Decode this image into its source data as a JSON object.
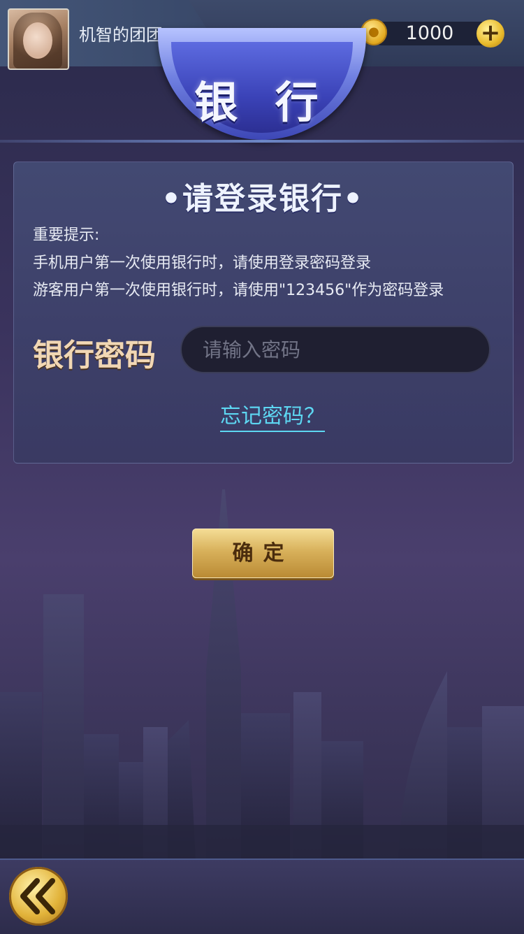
{
  "header": {
    "username": "机智的团团",
    "coins": "1000",
    "coin_glyph": "●",
    "plus_label": "+"
  },
  "banner": {
    "title": "银 行"
  },
  "panel": {
    "title": "•请登录银行•",
    "hints": [
      "重要提示:",
      "手机用户第一次使用银行时，请使用登录密码登录",
      "游客用户第一次使用银行时，请使用\"123456\"作为密码登录"
    ],
    "password_label": "银行密码",
    "password_placeholder": "请输入密码",
    "password_value": "",
    "forgot_link": "忘记密码？"
  },
  "confirm_label": "确定",
  "colors": {
    "accent_link": "#5dd7f2",
    "gold": "#d8b15b",
    "label_gold": "#f1d7b4"
  },
  "icons": {
    "coin": "coin-icon",
    "plus": "plus-icon",
    "back": "double-chevron-left-icon"
  }
}
